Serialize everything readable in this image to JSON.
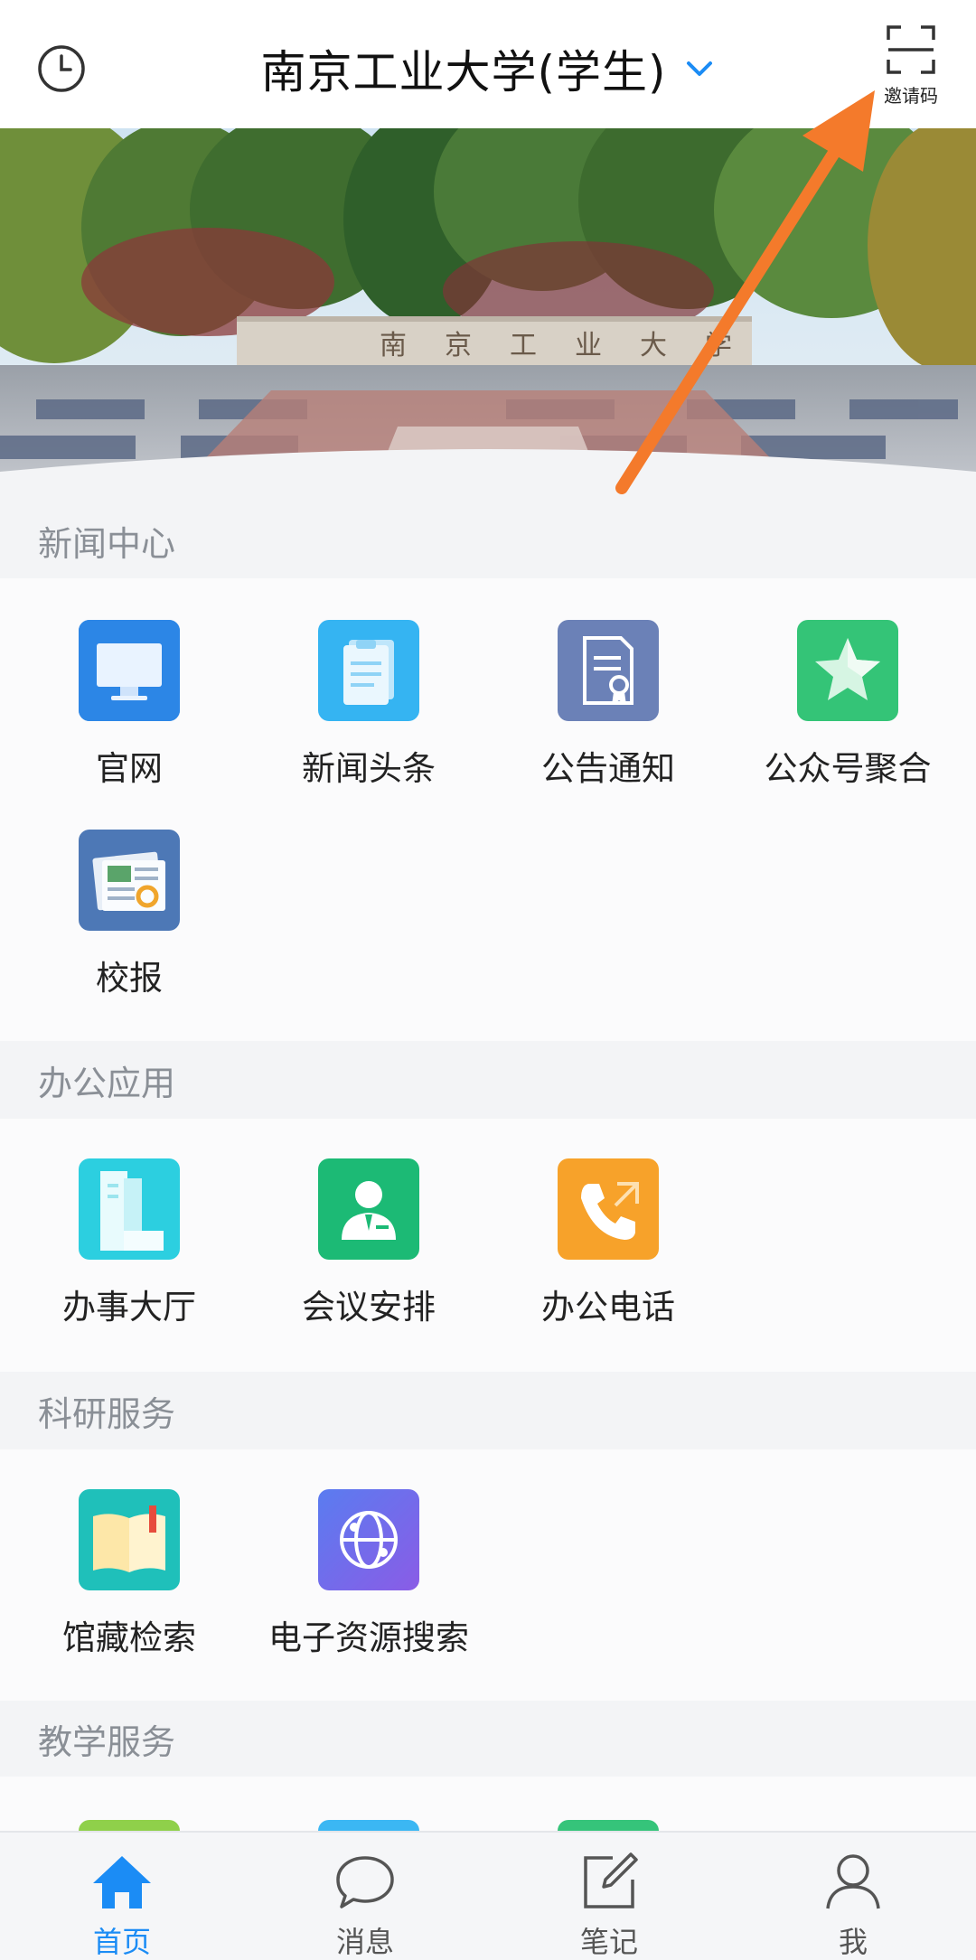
{
  "header": {
    "title": "南京工业大学(学生)",
    "history_icon": "clock-icon",
    "dropdown_icon": "chevron-down-icon",
    "invite_icon": "scan-frame-icon",
    "invite_label": "邀请码"
  },
  "banner": {
    "gate_inscription": "南京工业大学"
  },
  "sections": [
    {
      "title": "新闻中心",
      "items": [
        {
          "label": "官网",
          "icon": "monitor-icon",
          "color": "#2f8ee8"
        },
        {
          "label": "新闻头条",
          "icon": "clipboard-icon",
          "color": "#3bb7f3"
        },
        {
          "label": "公告通知",
          "icon": "certificate-icon",
          "color": "#6d82b8"
        },
        {
          "label": "公众号聚合",
          "icon": "star-icon",
          "color": "#35c47a"
        },
        {
          "label": "校报",
          "icon": "newspaper-icon",
          "color": "#4f79b8"
        }
      ]
    },
    {
      "title": "办公应用",
      "items": [
        {
          "label": "办事大厅",
          "icon": "building-icon",
          "color": "#2ed0e0"
        },
        {
          "label": "会议安排",
          "icon": "person-tie-icon",
          "color": "#1dbb76"
        },
        {
          "label": "办公电话",
          "icon": "phone-icon",
          "color": "#f7a42a"
        }
      ]
    },
    {
      "title": "科研服务",
      "items": [
        {
          "label": "馆藏检索",
          "icon": "book-icon",
          "color": "#1fc1bb"
        },
        {
          "label": "电子资源搜索",
          "icon": "globe-icon",
          "color": "#7b68e6"
        }
      ]
    },
    {
      "title": "教学服务",
      "items": []
    }
  ],
  "bottom_nav": [
    {
      "label": "首页",
      "icon": "home-icon",
      "active": true
    },
    {
      "label": "消息",
      "icon": "chat-bubble-icon",
      "active": false
    },
    {
      "label": "笔记",
      "icon": "edit-note-icon",
      "active": false
    },
    {
      "label": "我",
      "icon": "user-icon",
      "active": false
    }
  ],
  "colors": {
    "accent": "#1b8cf5",
    "annotation_arrow": "#f47a2b"
  }
}
